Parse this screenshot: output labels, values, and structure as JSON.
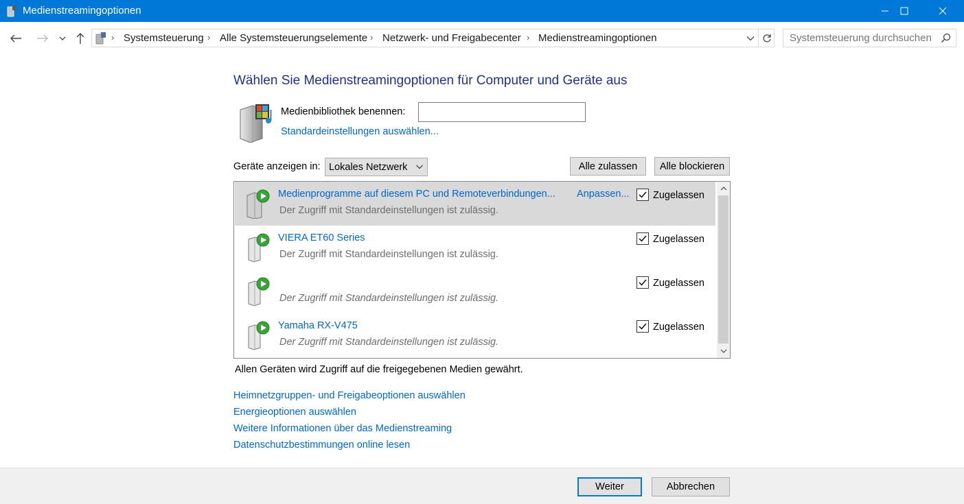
{
  "window": {
    "title": "Medienstreamingoptionen",
    "minimize_icon": "minimize-icon",
    "maximize_icon": "maximize-icon",
    "close_icon": "close-icon"
  },
  "navigation": {
    "breadcrumbs": [
      "Systemsteuerung",
      "Alle Systemsteuerungselemente",
      "Netzwerk- und Freigabecenter",
      "Medienstreamingoptionen"
    ],
    "search_placeholder": "Systemsteuerung durchsuchen"
  },
  "main": {
    "heading": "Wählen Sie Medienstreamingoptionen für Computer und Geräte aus",
    "library_label": "Medienbibliothek benennen:",
    "library_value": "",
    "default_settings_link": "Standardeinstellungen auswählen...",
    "show_devices_label": "Geräte anzeigen in:",
    "show_devices_value": "Lokales Netzwerk",
    "allow_all_label": "Alle zulassen",
    "block_all_label": "Alle blockieren",
    "devices": [
      {
        "name": "Medienprogramme auf diesem PC und Remoteverbindungen...",
        "desc": "Der Zugriff mit Standardeinstellungen ist zulässig.",
        "customize": "Anpassen...",
        "status": "Zugelassen",
        "checked": true,
        "selected": true
      },
      {
        "name": "VIERA ET60 Series",
        "desc": "Der Zugriff mit Standardeinstellungen ist zulässig.",
        "status": "Zugelassen",
        "checked": true
      },
      {
        "name": "",
        "desc": "Der Zugriff mit Standardeinstellungen ist zulässig.",
        "status": "Zugelassen",
        "checked": true,
        "italic": true
      },
      {
        "name": "Yamaha RX-V475",
        "desc": "Der Zugriff mit Standardeinstellungen ist zulässig.",
        "status": "Zugelassen",
        "checked": true,
        "italic": true
      }
    ],
    "info_text": "Allen Geräten wird Zugriff auf die freigegebenen Medien gewährt.",
    "links": [
      "Heimnetzgruppen- und Freigabeoptionen auswählen",
      "Energieoptionen auswählen",
      "Weitere Informationen über das Medienstreaming",
      "Datenschutzbestimmungen online lesen"
    ]
  },
  "footer": {
    "next_label": "Weiter",
    "cancel_label": "Abbrechen"
  },
  "colors": {
    "titlebar": "#0078d7",
    "heading": "#1e3287",
    "link": "#0066cc",
    "selected_row": "#d9d9d9"
  }
}
